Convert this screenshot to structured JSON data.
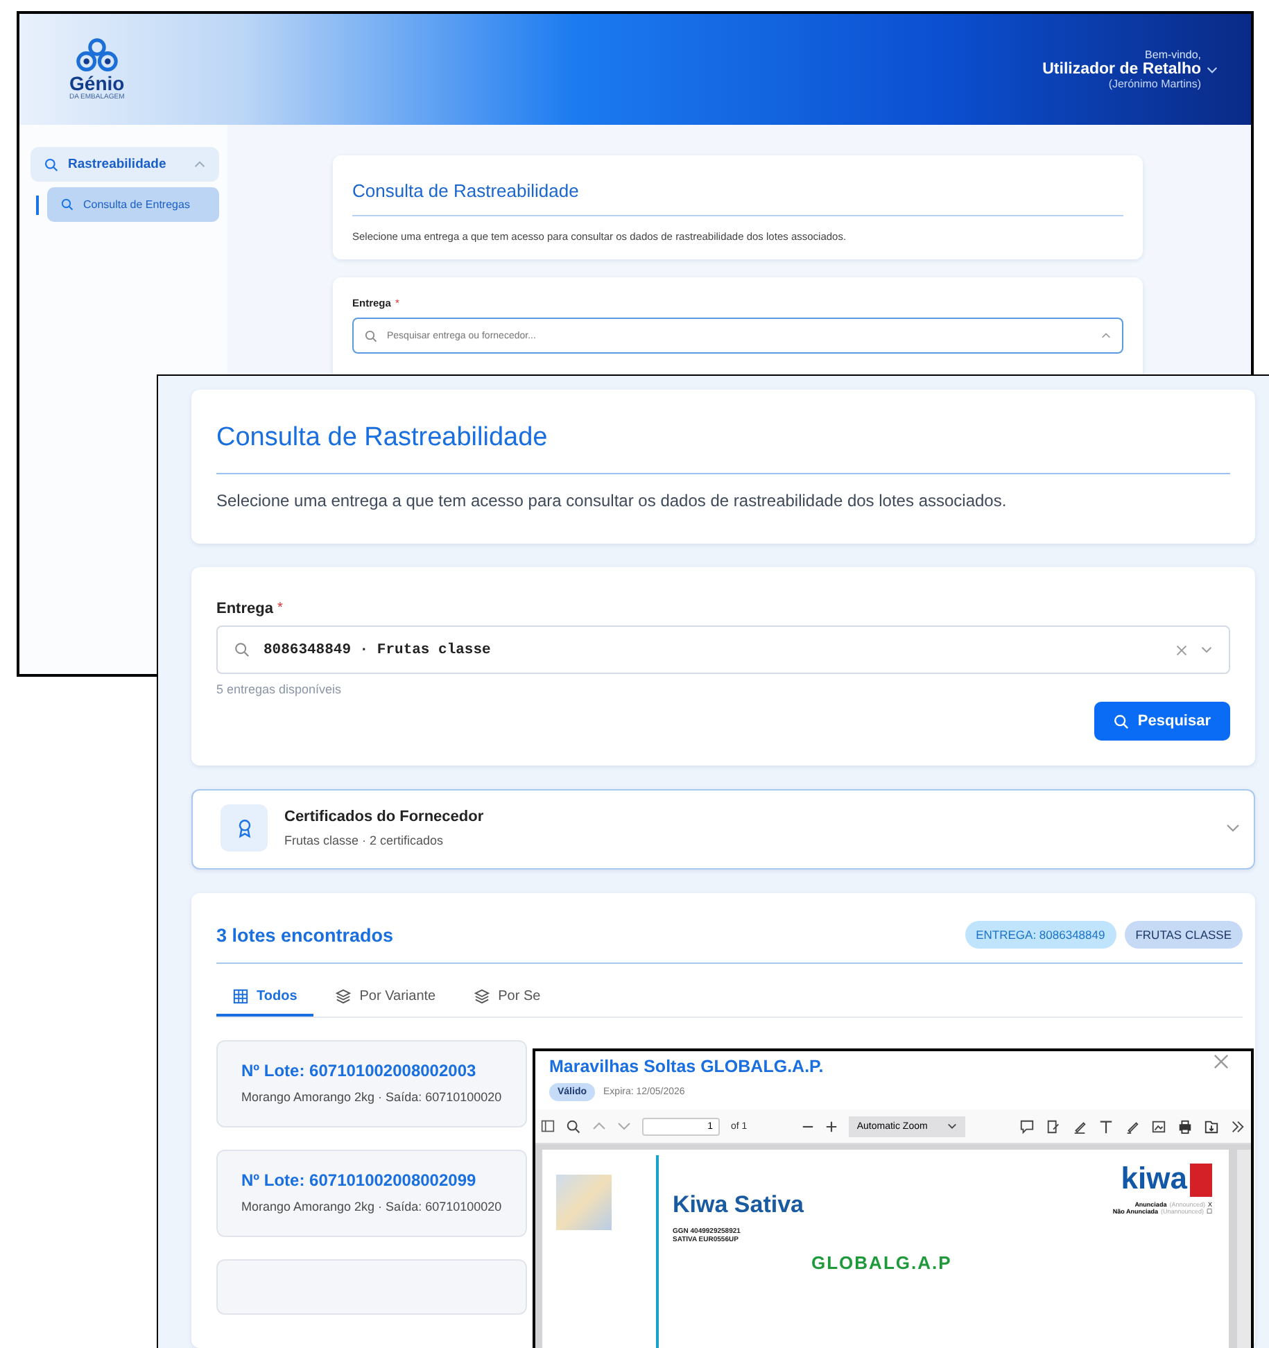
{
  "header": {
    "logo_name": "Génio",
    "logo_sub": "DA EMBALAGEM",
    "greeting": "Bem-vindo,",
    "user": "Utilizador de Retalho",
    "company": "(Jerónimo Martins)"
  },
  "sidebar": {
    "items": [
      {
        "label": "Rastreabilidade",
        "expanded": true,
        "children": [
          {
            "label": "Consulta de Entregas",
            "selected": true
          }
        ]
      }
    ]
  },
  "back_page": {
    "title": "Consulta de Rastreabilidade",
    "description": "Selecione uma entrega a que tem acesso para consultar os dados de rastreabilidade dos lotes associados.",
    "field_label": "Entrega",
    "required": "*",
    "placeholder": "Pesquisar entrega ou fornecedor...",
    "open": true
  },
  "front_page": {
    "title": "Consulta de Rastreabilidade",
    "description": "Selecione uma entrega a que tem acesso para consultar os dados de rastreabilidade dos lotes associados.",
    "field_label": "Entrega",
    "required": "*",
    "value": "8086348849 · Frutas classe",
    "hint": "5 entregas disponíveis",
    "search_button": "Pesquisar",
    "certificates": {
      "title": "Certificados do Fornecedor",
      "subtitle": "Frutas classe · 2 certificados",
      "expanded": false
    },
    "results": {
      "title": "3 lotes encontrados",
      "badges": [
        {
          "label": "ENTREGA: 8086348849",
          "color": "#bfe4fb"
        },
        {
          "label": "FRUTAS CLASSE",
          "color": "#c6daf6"
        }
      ],
      "tabs": [
        {
          "label": "Todos",
          "selected": true
        },
        {
          "label": "Por Variante",
          "selected": false
        },
        {
          "label": "Por Se",
          "selected": false
        }
      ],
      "lots": [
        {
          "title": "Nº Lote: 607101002008002003",
          "detail": "Morango Amorango 2kg · Saída: 60710100020"
        },
        {
          "title": "Nº Lote: 607101002008002099",
          "detail": "Morango Amorango 2kg · Saída: 60710100020"
        }
      ]
    }
  },
  "viewer": {
    "title": "Maravilhas Soltas GLOBALG.A.P.",
    "status": "Válido",
    "expiry": "Expira: 12/05/2026",
    "page": "1",
    "page_count": "of 1",
    "zoom": "Automatic Zoom",
    "document": {
      "brand": "Kiwa Sativa",
      "logo": "kiwa",
      "lines": [
        "GGN 4049929258921",
        "SATIVA EUR0556UP"
      ],
      "audit": [
        {
          "label": "Anunciada",
          "note": "(Announced)",
          "mark": "X"
        },
        {
          "label": "Não Anunciada",
          "note": "(Unannounced)",
          "mark": "☐"
        }
      ],
      "standard": "GLOBALG.A.P"
    }
  }
}
